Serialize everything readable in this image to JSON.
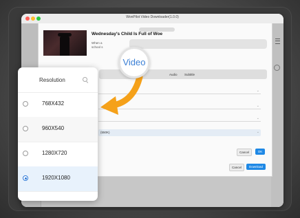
{
  "window": {
    "title": "WonPilot Video Downloader(1.0.0)"
  },
  "video": {
    "title": "Wednesday's Child Is Full of Woe",
    "desc_line1": "When a",
    "desc_line2": "school s"
  },
  "tabs": {
    "audio": "Audio",
    "subtitle": "Subtitle"
  },
  "fields": {
    "resolution_value": "(550K)"
  },
  "dialog_buttons": {
    "cancel": "Cancel",
    "ok": "OK"
  },
  "main_buttons": {
    "cancel": "Cancel",
    "download": "Download"
  },
  "callout": {
    "label": "Video"
  },
  "resolution_panel": {
    "header": "Resolution",
    "options": [
      {
        "label": "768X432",
        "selected": false
      },
      {
        "label": "960X540",
        "selected": false
      },
      {
        "label": "1280X720",
        "selected": false
      },
      {
        "label": "1920X1080",
        "selected": true
      }
    ]
  },
  "colors": {
    "accent": "#2f7ad8",
    "arrow": "#f5a11a",
    "callout_text": "#3a7fd5"
  }
}
